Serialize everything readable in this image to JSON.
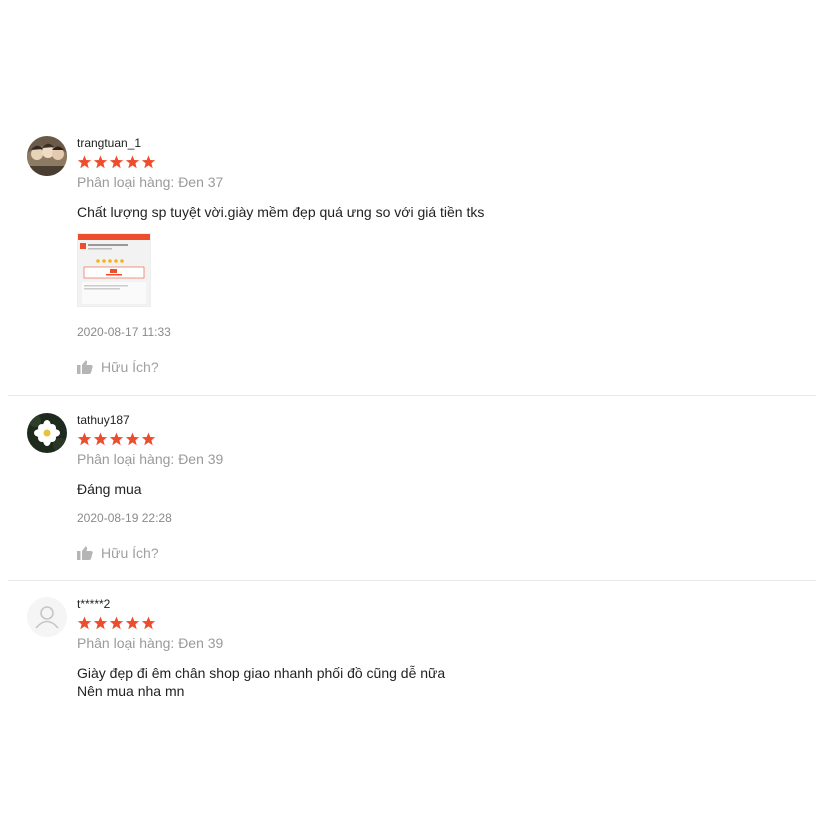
{
  "colors": {
    "star": "#ee4d2d",
    "muted": "#9a9a9a",
    "divider": "#e8e8e8"
  },
  "icons": {
    "star": "star-icon",
    "like": "thumbs-up-icon",
    "default_avatar": "user-icon"
  },
  "reviews": [
    {
      "username": "trangtuan_1",
      "rating": 5,
      "variation": "Phân loại hàng: Đen 37",
      "comment": "Chất lượng sp tuyệt vời.giày mềm đẹp quá ưng so với giá tiền tks",
      "timestamp": "2020-08-17 11:33",
      "helpful_label": "Hữu Ích?"
    },
    {
      "username": "tathuy187",
      "rating": 5,
      "variation": "Phân loại hàng: Đen 39",
      "comment": "Đáng mua",
      "timestamp": "2020-08-19 22:28",
      "helpful_label": "Hữu Ích?"
    },
    {
      "username": "t*****2",
      "rating": 5,
      "variation": "Phân loại hàng: Đen 39",
      "comment_line1": "Giày đẹp đi êm chân shop giao nhanh phối đồ cũng dễ nữa",
      "comment_line2": "Nên mua nha mn"
    }
  ]
}
